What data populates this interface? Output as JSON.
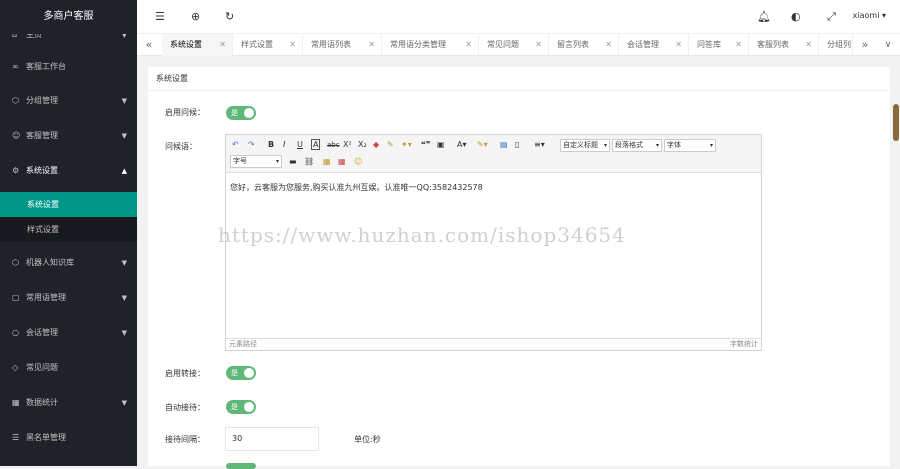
{
  "sidebar": {
    "brand": "多商户客服",
    "items": [
      {
        "label": "主页",
        "icon": "home-icon"
      },
      {
        "label": "客服工作台",
        "icon": "link-icon"
      },
      {
        "label": "分组管理",
        "icon": "box-icon"
      },
      {
        "label": "客服管理",
        "icon": "user-icon"
      },
      {
        "label": "系统设置",
        "icon": "gear-icon"
      },
      {
        "label": "机器人知识库",
        "icon": "box-icon"
      },
      {
        "label": "常用语管理",
        "icon": "doc-icon"
      },
      {
        "label": "会话管理",
        "icon": "chat-icon"
      },
      {
        "label": "常见问题",
        "icon": "shield-icon"
      },
      {
        "label": "数据统计",
        "icon": "chart-icon"
      },
      {
        "label": "黑名单管理",
        "icon": "list-icon"
      }
    ],
    "sub_items": [
      "系统设置",
      "样式设置"
    ]
  },
  "topbar": {
    "user": "xiaomi"
  },
  "tabs": [
    "系统设置",
    "样式设置",
    "常用语列表",
    "常用语分类管理",
    "常见问题",
    "留言列表",
    "会话管理",
    "问答库",
    "客服列表",
    "分组列"
  ],
  "panel": {
    "title": "系统设置",
    "greeting_enable_label": "启用问候：",
    "greeting_label": "问候语：",
    "switch_on": "是",
    "editor": {
      "heading_select": "自定义标题",
      "paragraph_select": "段落格式",
      "font_select": "字体",
      "size_select": "字号",
      "content": "您好，云客服为您服务,购买认准九州互娱。认准唯一QQ:3582432578",
      "footer_left": "元素路径",
      "footer_right": "字数统计"
    },
    "transfer_label": "启用转接：",
    "auto_accept_label": "自动接待：",
    "interval_label": "接待间隔：",
    "interval_value": "30",
    "interval_unit": "单位:秒"
  },
  "watermark": "https://www.huzhan.com/ishop34654"
}
